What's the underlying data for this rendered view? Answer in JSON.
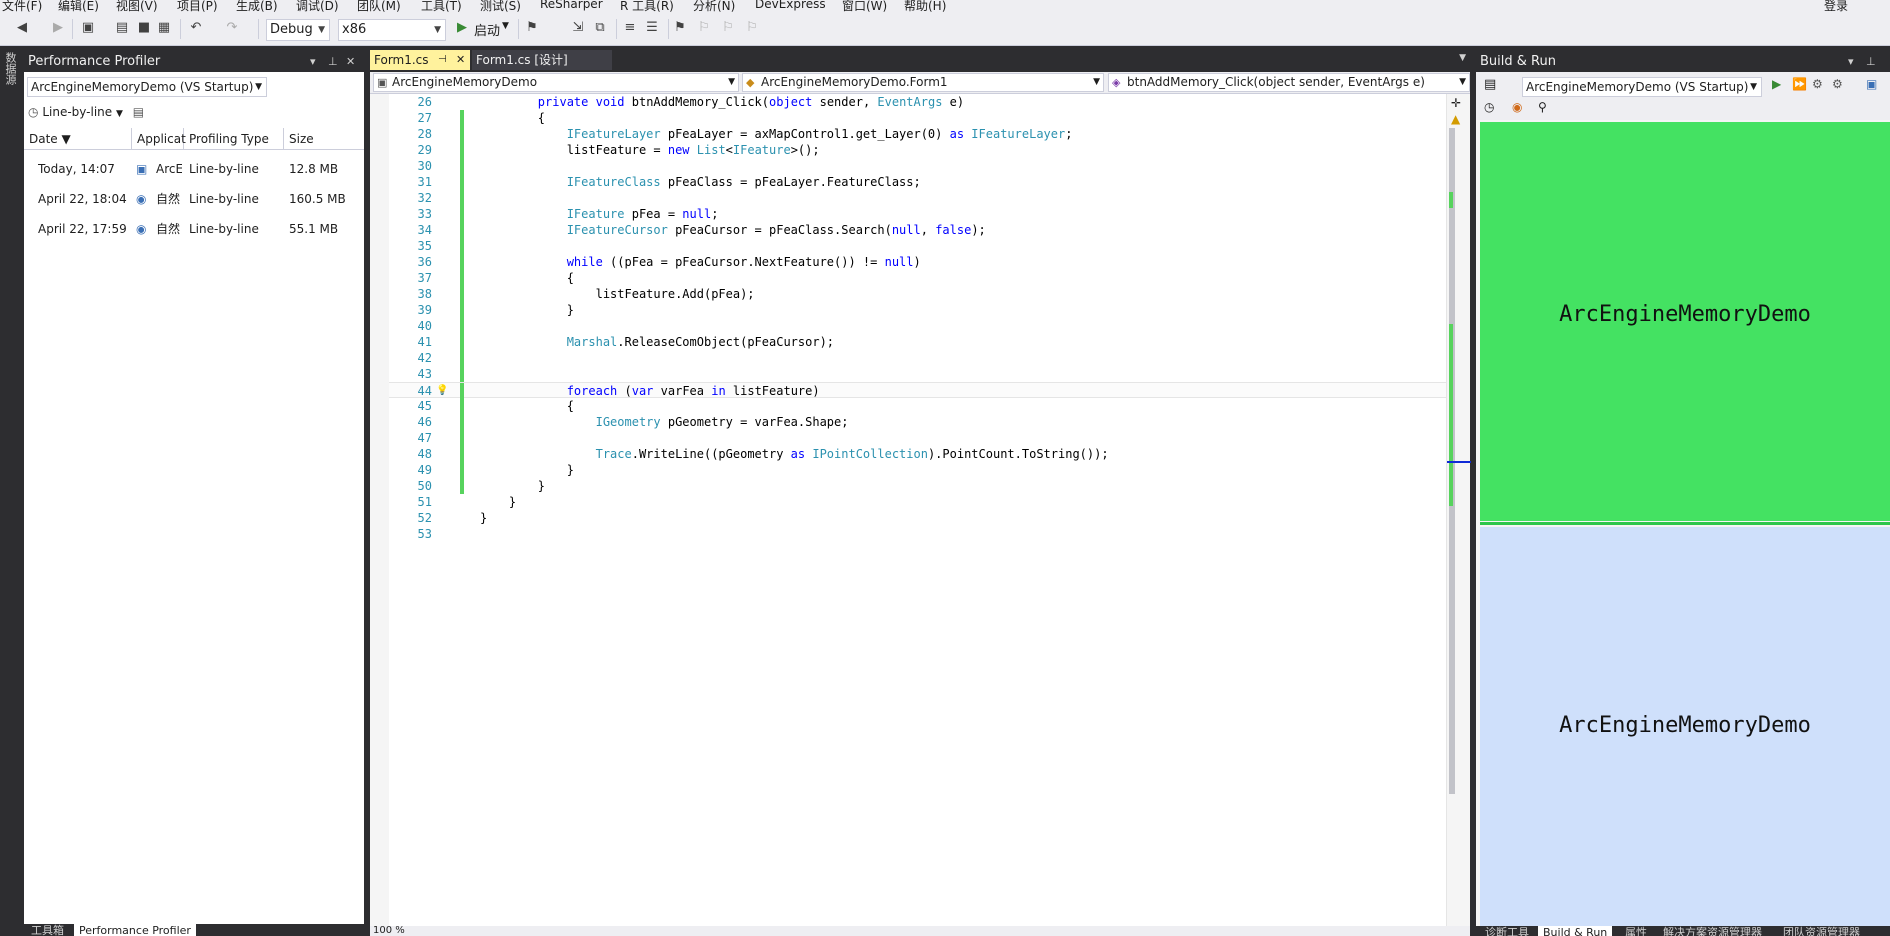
{
  "menu": [
    "文件(F)",
    "编辑(E)",
    "视图(V)",
    "项目(P)",
    "生成(B)",
    "调试(D)",
    "团队(M)",
    "工具(T)",
    "测试(S)",
    "ReSharper",
    "R 工具(R)",
    "分析(N)",
    "DevExpress",
    "窗口(W)",
    "帮助(H)"
  ],
  "login": "登录",
  "toolbar": {
    "config": "Debug",
    "platform": "x86",
    "start_label": "启动"
  },
  "left_strip_label": "数据源",
  "perf": {
    "title": "Performance Profiler",
    "project": "ArcEngineMemoryDemo (VS Startup)",
    "mode": "Line-by-line",
    "columns": [
      "Date ▼",
      "Applicat",
      "Profiling Type",
      "Size"
    ],
    "rows": [
      {
        "date": "Today, 14:07",
        "app": "ArcE",
        "type": "Line-by-line",
        "size": "12.8 MB"
      },
      {
        "date": "April 22, 18:04",
        "app": "自然",
        "type": "Line-by-line",
        "size": "160.5 MB"
      },
      {
        "date": "April 22, 17:59",
        "app": "自然",
        "type": "Line-by-line",
        "size": "55.1 MB"
      }
    ],
    "bottom_tabs": [
      "工具箱",
      "Performance Profiler"
    ]
  },
  "editor": {
    "tabs": [
      "Form1.cs",
      "Form1.cs [设计]"
    ],
    "nav": [
      "ArcEngineMemoryDemo",
      "ArcEngineMemoryDemo.Form1",
      "btnAddMemory_Click(object sender, EventArgs e)"
    ],
    "zoom": "100 %",
    "lines": [
      {
        "n": "26",
        "html": "        <span class='kw'>private</span> <span class='kw'>void</span> btnAddMemory_Click(<span class='kw'>object</span> sender, <span class='ty'>EventArgs</span> e)"
      },
      {
        "n": "27",
        "html": "        {"
      },
      {
        "n": "28",
        "html": "            <span class='ty'>IFeatureLayer</span> pFeaLayer = axMapControl1.get_Layer(0) <span class='kw'>as</span> <span class='ty'>IFeatureLayer</span>;"
      },
      {
        "n": "29",
        "html": "            listFeature = <span class='kw'>new</span> <span class='ty'>List</span>&lt;<span class='ty'>IFeature</span>&gt;();"
      },
      {
        "n": "30",
        "html": ""
      },
      {
        "n": "31",
        "html": "            <span class='ty'>IFeatureClass</span> pFeaClass = pFeaLayer.FeatureClass;"
      },
      {
        "n": "32",
        "html": ""
      },
      {
        "n": "33",
        "html": "            <span class='ty'>IFeature</span> pFea = <span class='nl'>null</span>;"
      },
      {
        "n": "34",
        "html": "            <span class='ty'>IFeatureCursor</span> pFeaCursor = pFeaClass.Search(<span class='kw'>null</span>, <span class='kw'>false</span>);"
      },
      {
        "n": "35",
        "html": ""
      },
      {
        "n": "36",
        "html": "            <span class='kw'>while</span> ((pFea = pFeaCursor.NextFeature()) != <span class='kw'>null</span>)"
      },
      {
        "n": "37",
        "html": "            {"
      },
      {
        "n": "38",
        "html": "                listFeature.Add(pFea);"
      },
      {
        "n": "39",
        "html": "            }"
      },
      {
        "n": "40",
        "html": ""
      },
      {
        "n": "41",
        "html": "            <span class='ty'>Marshal</span>.ReleaseComObject(pFeaCursor);"
      },
      {
        "n": "42",
        "html": ""
      },
      {
        "n": "43",
        "html": ""
      },
      {
        "n": "44",
        "html": "            <span class='kw'>foreach</span> (<span class='kw'>var</span> varFea <span class='kw'>in</span> listFeature)"
      },
      {
        "n": "45",
        "html": "            {"
      },
      {
        "n": "46",
        "html": "                <span class='ty'>IGeometry</span> pGeometry = varFea.Shape;"
      },
      {
        "n": "47",
        "html": ""
      },
      {
        "n": "48",
        "html": "                <span class='ty'>Trace</span>.WriteLine((pGeometry <span class='kw'>as</span> <span class='ty'>IPointCollection</span>).PointCount.ToString());"
      },
      {
        "n": "49",
        "html": "            }"
      },
      {
        "n": "50",
        "html": "        }"
      },
      {
        "n": "51",
        "html": "    }"
      },
      {
        "n": "52",
        "html": "}"
      },
      {
        "n": "53",
        "html": ""
      }
    ]
  },
  "build": {
    "title": "Build & Run",
    "project": "ArcEngineMemoryDemo (VS Startup)",
    "green_text": "ArcEngineMemoryDemo",
    "blue_text": "ArcEngineMemoryDemo",
    "bottom_tabs": [
      "诊断工具",
      "Build & Run",
      "属性",
      "解决方案资源管理器",
      "团队资源管理器"
    ]
  }
}
